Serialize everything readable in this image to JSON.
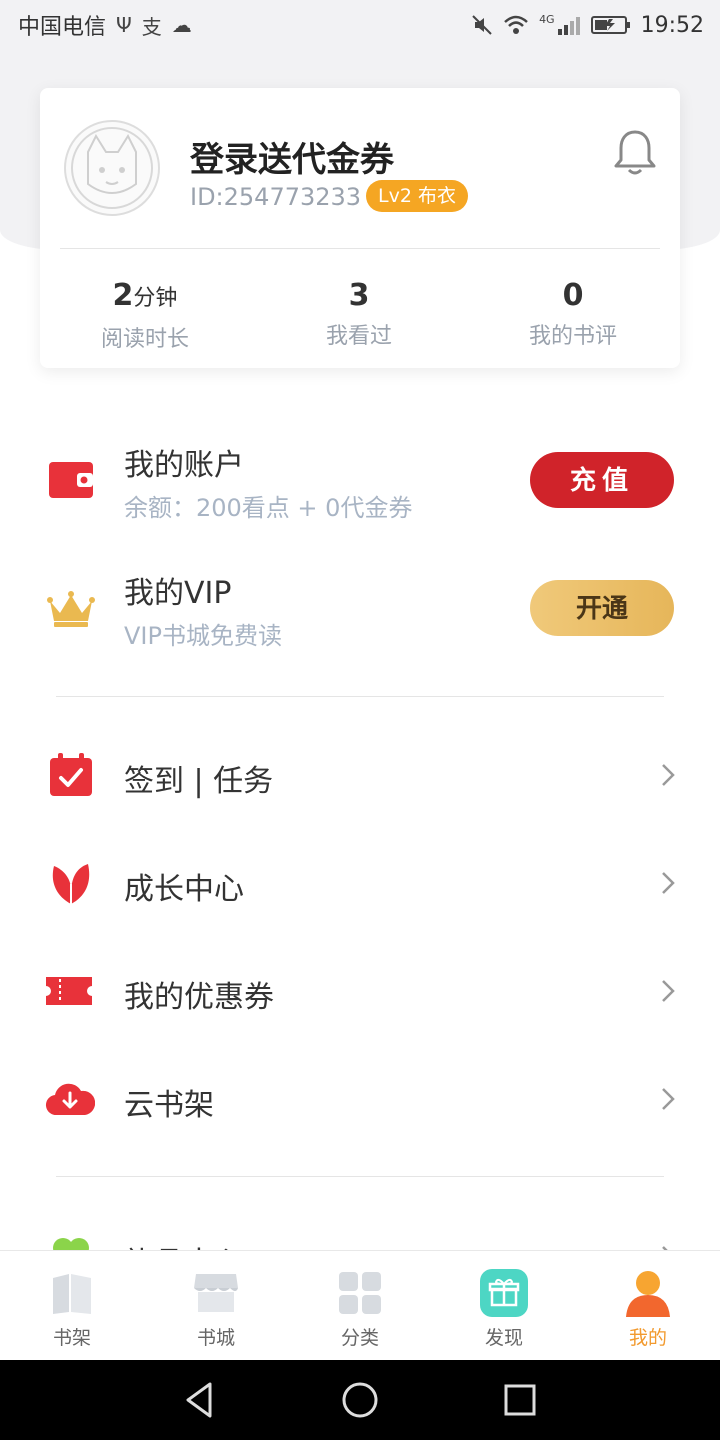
{
  "status_bar": {
    "carrier": "中国电信",
    "time": "19:52",
    "network": "4G"
  },
  "profile": {
    "nickname": "登录送代金券",
    "user_id": "ID:254773233",
    "level": "Lv2 布衣",
    "stats": [
      {
        "value": "2",
        "unit": "分钟",
        "label": "阅读时长"
      },
      {
        "value": "3",
        "unit": "",
        "label": "我看过"
      },
      {
        "value": "0",
        "unit": "",
        "label": "我的书评"
      }
    ]
  },
  "account": {
    "title": "我的账户",
    "balance": "余额：200看点 + 0代金券",
    "recharge_label": "充值"
  },
  "vip": {
    "title": "我的VIP",
    "subtitle": "VIP书城免费读",
    "open_label": "开通"
  },
  "menu": [
    {
      "label": "签到 | 任务",
      "icon": "calendar-check-icon"
    },
    {
      "label": "成长中心",
      "icon": "leaf-icon"
    },
    {
      "label": "我的优惠券",
      "icon": "ticket-icon"
    },
    {
      "label": "云书架",
      "icon": "cloud-download-icon"
    }
  ],
  "partial_menu_label": "礼品中心",
  "bottom_nav": [
    {
      "label": "书架",
      "icon": "book-icon"
    },
    {
      "label": "书城",
      "icon": "store-icon"
    },
    {
      "label": "分类",
      "icon": "grid-icon"
    },
    {
      "label": "发现",
      "icon": "gift-icon"
    },
    {
      "label": "我的",
      "icon": "person-icon",
      "active": true
    }
  ],
  "colors": {
    "accent_red": "#d0232a",
    "vip_gold": "#e6b65a",
    "level_orange": "#f5a623",
    "active_tab": "#f29a2e"
  }
}
